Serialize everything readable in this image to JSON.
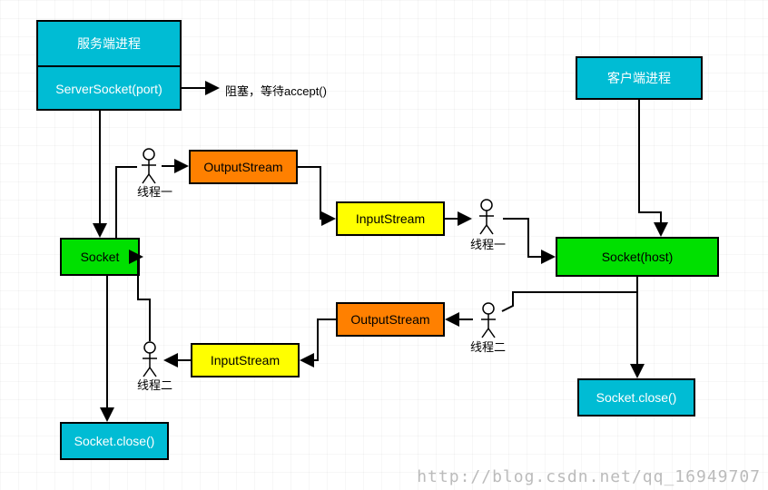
{
  "diagram": {
    "serverProcess": "服务端进程",
    "serverSocket": "ServerSocket(port)",
    "blockingNote": "阻塞，等待accept()",
    "leftSocket": "Socket",
    "leftStickTop": "线程一",
    "leftStickBottom": "线程二",
    "leftOutputStream": "OutputStream",
    "leftInputStream": "InputStream",
    "leftSocketClose": "Socket.close()",
    "rightInputStream": "InputStream",
    "rightOutputStream": "OutputStream",
    "rightStickTop": "线程一",
    "rightStickBottom": "线程二",
    "clientProcess": "客户端进程",
    "rightSocket": "Socket(host)",
    "rightSocketClose": "Socket.close()",
    "watermark": "http://blog.csdn.net/qq_16949707"
  }
}
